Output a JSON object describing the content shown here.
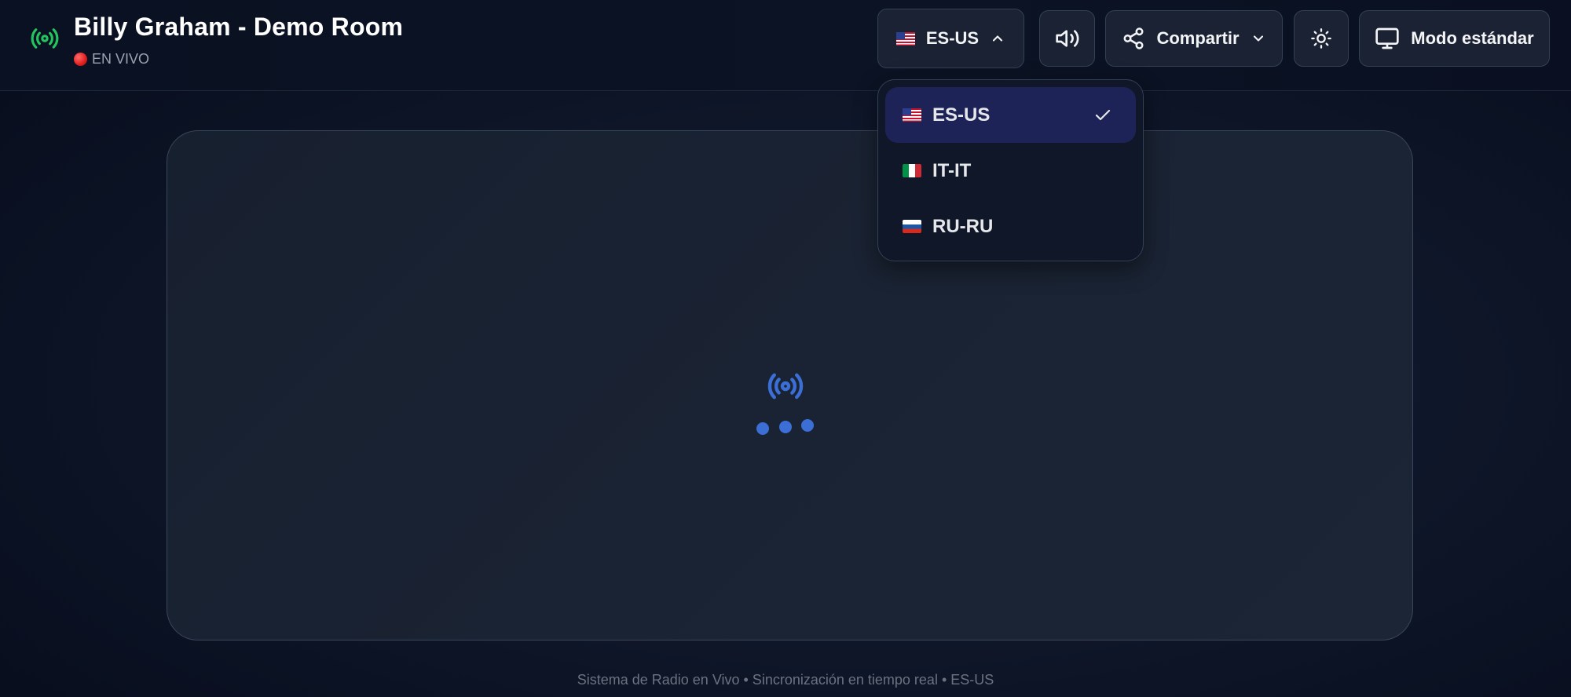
{
  "header": {
    "title": "Billy Graham - Demo Room",
    "live_label": "EN VIVO",
    "language_button": {
      "label": "ES-US",
      "icon": "chevron-up-icon"
    },
    "volume_button": {
      "icon": "volume-icon"
    },
    "share_button": {
      "label": "Compartir",
      "icon": "share-icon"
    },
    "theme_button": {
      "icon": "sun-icon"
    },
    "mode_button": {
      "label": "Modo estándar",
      "icon": "monitor-icon"
    }
  },
  "language_dropdown": {
    "options": [
      {
        "label": "ES-US",
        "flag": "us",
        "selected": true
      },
      {
        "label": "IT-IT",
        "flag": "it",
        "selected": false
      },
      {
        "label": "RU-RU",
        "flag": "ru",
        "selected": false
      }
    ]
  },
  "footer": {
    "text": "Sistema de Radio en Vivo • Sincronización en tiempo real • ES-US"
  },
  "colors": {
    "brand_green": "#22c55e",
    "accent_blue": "#3b6fd6",
    "selected_option_bg": "#1e2357",
    "live_red": "#e11d1d"
  }
}
